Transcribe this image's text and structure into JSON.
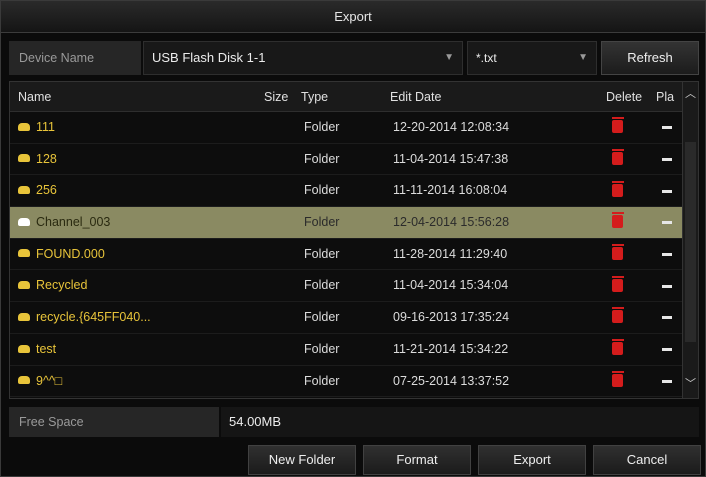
{
  "window": {
    "title": "Export"
  },
  "device": {
    "label": "Device Name",
    "selected": "USB Flash Disk 1-1",
    "file_filter": "*.txt",
    "refresh_label": "Refresh"
  },
  "table": {
    "columns": {
      "name": "Name",
      "size": "Size",
      "type": "Type",
      "date": "Edit Date",
      "delete": "Delete",
      "play": "Pla"
    },
    "rows": [
      {
        "name": "111",
        "type": "Folder",
        "date": "12-20-2014 12:08:34"
      },
      {
        "name": "128",
        "type": "Folder",
        "date": "11-04-2014 15:47:38"
      },
      {
        "name": "256",
        "type": "Folder",
        "date": "11-11-2014 16:08:04"
      },
      {
        "name": "Channel_003",
        "type": "Folder",
        "date": "12-04-2014 15:56:28"
      },
      {
        "name": "FOUND.000",
        "type": "Folder",
        "date": "11-28-2014 11:29:40"
      },
      {
        "name": "Recycled",
        "type": "Folder",
        "date": "11-04-2014 15:34:04"
      },
      {
        "name": "recycle.{645FF040...",
        "type": "Folder",
        "date": "09-16-2013 17:35:24"
      },
      {
        "name": "test",
        "type": "Folder",
        "date": "11-21-2014 15:34:22"
      },
      {
        "name": "9^^□",
        "type": "Folder",
        "date": "07-25-2014 13:37:52"
      }
    ],
    "selected_index": 3
  },
  "free_space": {
    "label": "Free Space",
    "value": "54.00MB"
  },
  "buttons": {
    "new_folder": "New Folder",
    "format": "Format",
    "export": "Export",
    "cancel": "Cancel"
  },
  "colors": {
    "folder": "#e8c43a",
    "selected_row": "#8a8a62",
    "delete": "#d41c1c"
  }
}
